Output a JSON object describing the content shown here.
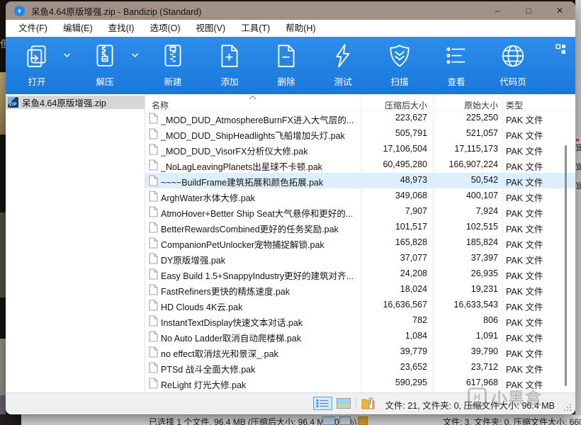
{
  "window": {
    "title": "呆鱼4.64原版增强.zip - Bandizip (Standard)",
    "controls": {
      "minimize": "–",
      "maximize": "□",
      "close": "✕"
    }
  },
  "menu": {
    "items": [
      "文件(F)",
      "编辑(E)",
      "查找(I)",
      "选项(O)",
      "视图(V)",
      "工具(T)",
      "帮助(H)"
    ]
  },
  "toolbar": {
    "buttons": [
      {
        "id": "open",
        "label": "打开",
        "icon": "open-icon",
        "dropdown": true
      },
      {
        "id": "extract",
        "label": "解压",
        "icon": "extract-icon",
        "dropdown": true
      },
      {
        "id": "new",
        "label": "新建",
        "icon": "new-archive-icon",
        "dropdown": false
      },
      {
        "id": "add",
        "label": "添加",
        "icon": "add-file-icon",
        "dropdown": false
      },
      {
        "id": "delete",
        "label": "删除",
        "icon": "delete-file-icon",
        "dropdown": false
      },
      {
        "id": "test",
        "label": "测试",
        "icon": "test-icon",
        "dropdown": false
      },
      {
        "id": "scan",
        "label": "扫描",
        "icon": "scan-icon",
        "dropdown": false
      },
      {
        "id": "view",
        "label": "查看",
        "icon": "view-icon",
        "dropdown": false
      },
      {
        "id": "codepage",
        "label": "代码页",
        "icon": "codepage-icon",
        "dropdown": false
      }
    ]
  },
  "sidebar": {
    "items": [
      {
        "label": "呆鱼4.64原版增强.zip",
        "icon": "zip-file-icon",
        "selected": true
      }
    ]
  },
  "file_list": {
    "columns": [
      "名称",
      "压缩后大小",
      "原始大小",
      "类型"
    ],
    "sort": {
      "column": "名称",
      "direction": "asc"
    },
    "selected_index": 4,
    "rows": [
      {
        "name": "_MOD_DUD_AtmosphereBurnFX进入大气层的...",
        "packed": "223,627",
        "original": "225,250",
        "type": "PAK 文件"
      },
      {
        "name": "_MOD_DUD_ShipHeadlights飞船增加头灯.pak",
        "packed": "505,791",
        "original": "521,057",
        "type": "PAK 文件"
      },
      {
        "name": "_MOD_DUD_VisorFX分析仪大修.pak",
        "packed": "17,106,504",
        "original": "17,115,173",
        "type": "PAK 文件"
      },
      {
        "name": "_NoLagLeavingPlanets出星球不卡顿.pak",
        "packed": "60,495,280",
        "original": "166,907,224",
        "type": "PAK 文件"
      },
      {
        "name": "~~~~BuildFrame建筑拓展和颜色拓展.pak",
        "packed": "48,973",
        "original": "50,542",
        "type": "PAK 文件"
      },
      {
        "name": "ArghWater水体大修.pak",
        "packed": "349,068",
        "original": "400,107",
        "type": "PAK 文件"
      },
      {
        "name": "AtmoHover+Better Ship Seat大气悬停和更好的...",
        "packed": "7,907",
        "original": "7,924",
        "type": "PAK 文件"
      },
      {
        "name": "BetterRewardsCombined更好的任务奖励.pak",
        "packed": "101,517",
        "original": "102,515",
        "type": "PAK 文件"
      },
      {
        "name": "CompanionPetUnlocker宠物捕捉解锁.pak",
        "packed": "165,828",
        "original": "185,824",
        "type": "PAK 文件"
      },
      {
        "name": "DY原版增强.pak",
        "packed": "37,077",
        "original": "37,397",
        "type": "PAK 文件"
      },
      {
        "name": "Easy Build 1.5+SnappyIndustry更好的建筑对齐...",
        "packed": "24,208",
        "original": "26,935",
        "type": "PAK 文件"
      },
      {
        "name": "FastRefiners更快的精炼速度.pak",
        "packed": "18,024",
        "original": "19,231",
        "type": "PAK 文件"
      },
      {
        "name": "HD Clouds 4K云.pak",
        "packed": "16,636,567",
        "original": "16,633,543",
        "type": "PAK 文件"
      },
      {
        "name": "InstantTextDisplay快速文本对话.pak",
        "packed": "782",
        "original": "806",
        "type": "PAK 文件"
      },
      {
        "name": "No Auto Ladder取消自动爬楼梯.pak",
        "packed": "1,084",
        "original": "1,091",
        "type": "PAK 文件"
      },
      {
        "name": "no effect取消炫光和景深_.pak",
        "packed": "39,779",
        "original": "39,790",
        "type": "PAK 文件"
      },
      {
        "name": "PTSd 战斗全面大修.pak",
        "packed": "23,652",
        "original": "23,712",
        "type": "PAK 文件"
      },
      {
        "name": "ReLight 灯光大修.pak",
        "packed": "590,295",
        "original": "617,968",
        "type": "PAK 文件"
      }
    ]
  },
  "status_bar": {
    "summary": "文件: 21, 文件夹: 0, 压缩文件大小: 96.4 MB"
  },
  "watermark": {
    "logo_letter": "H",
    "text": "小黑盒"
  },
  "background": {
    "left_fragment_glyph": "但",
    "second_window_status_left": "已选择 1 个文件, 96.4 MB (压缩后大小: 96.4 MB, 0.0%)",
    "second_window_status_right": "文件: 3, 文件夹: 0, 压缩文件大小: 660",
    "side_glyphs": [
      "宜",
      "宜",
      "宜"
    ],
    "grip_dots": "⋮⋮"
  },
  "colors": {
    "titlebar": "#a29186",
    "toolbar_top": "#2e8de9",
    "toolbar_bottom": "#1879dc",
    "selection_row": "#ddeffc",
    "sidebar_selection": "#d6d6d6",
    "accent_blue": "#1e88e5",
    "folder_yellow": "#f2b42e"
  }
}
